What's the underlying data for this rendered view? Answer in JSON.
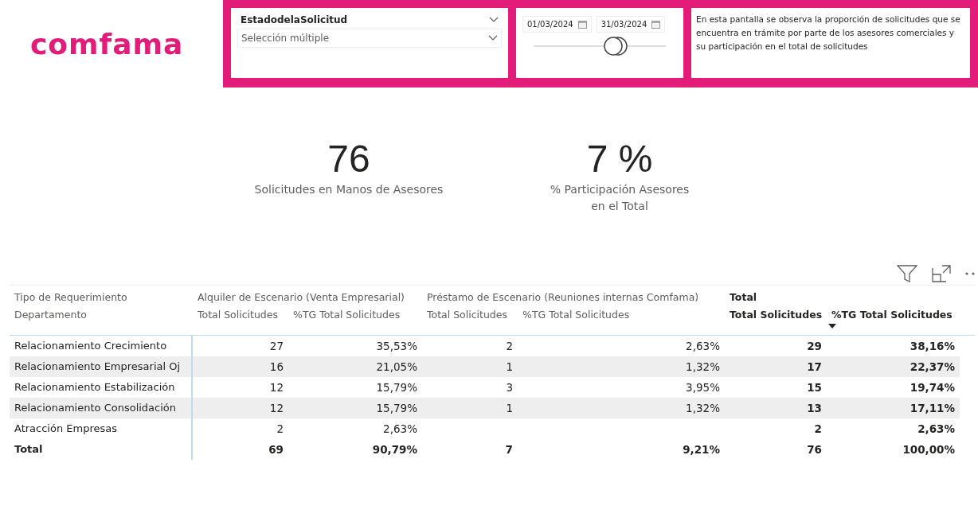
{
  "logo": "comfama",
  "filters": {
    "dropdown": {
      "title": "EstadodelaSolicitud",
      "placeholder": "Selección múltiple"
    },
    "date_range": {
      "start": "01/03/2024",
      "end": "31/03/2024",
      "level": 0.62
    }
  },
  "description": "En esta pantalla se observa la proporción de solicitudes que se encuentra en trámite por parte de los asesores comerciales y su participación en el total de solicitudes",
  "kpis": [
    {
      "value": "76",
      "label": "Solicitudes en Manos de Asesores"
    },
    {
      "value": "7 %",
      "label": "% Participación Asesores en el Total"
    }
  ],
  "table": {
    "row_header": [
      "Tipo de Requerimiento",
      "Departamento"
    ],
    "groups": [
      {
        "title": "Alquiler de Escenario (Venta Empresarial)",
        "bold": false
      },
      {
        "title": "Préstamo de Escenario (Reuniones internas Comfama)",
        "bold": false
      },
      {
        "title": "Total",
        "bold": true
      }
    ],
    "columns": [
      {
        "label": "Total Solicitudes",
        "sorted": false
      },
      {
        "label": "%TG Total Solicitudes",
        "sorted": false
      },
      {
        "label": "Total Solicitudes",
        "sorted": false
      },
      {
        "label": "%TG Total Solicitudes",
        "sorted": false
      },
      {
        "label": "Total Solicitudes",
        "sorted": false
      },
      {
        "label": "%TG Total Solicitudes",
        "sorted": true
      }
    ],
    "rows": [
      {
        "name": "Relacionamiento Crecimiento",
        "cells": [
          "27",
          "35,53%",
          "2",
          "2,63%",
          "29",
          "38,16%"
        ]
      },
      {
        "name": "Relacionamiento Empresarial Oj",
        "cells": [
          "16",
          "21,05%",
          "1",
          "1,32%",
          "17",
          "22,37%"
        ]
      },
      {
        "name": "Relacionamiento Estabilización",
        "cells": [
          "12",
          "15,79%",
          "3",
          "3,95%",
          "15",
          "19,74%"
        ]
      },
      {
        "name": "Relacionamiento Consolidación",
        "cells": [
          "12",
          "15,79%",
          "1",
          "1,32%",
          "13",
          "17,11%"
        ]
      },
      {
        "name": "Atracción Empresas",
        "cells": [
          "2",
          "2,63%",
          "",
          "",
          "2",
          "2,63%"
        ]
      }
    ],
    "total": {
      "name": "Total",
      "cells": [
        "69",
        "90,79%",
        "7",
        "9,21%",
        "76",
        "100,00%"
      ]
    }
  }
}
